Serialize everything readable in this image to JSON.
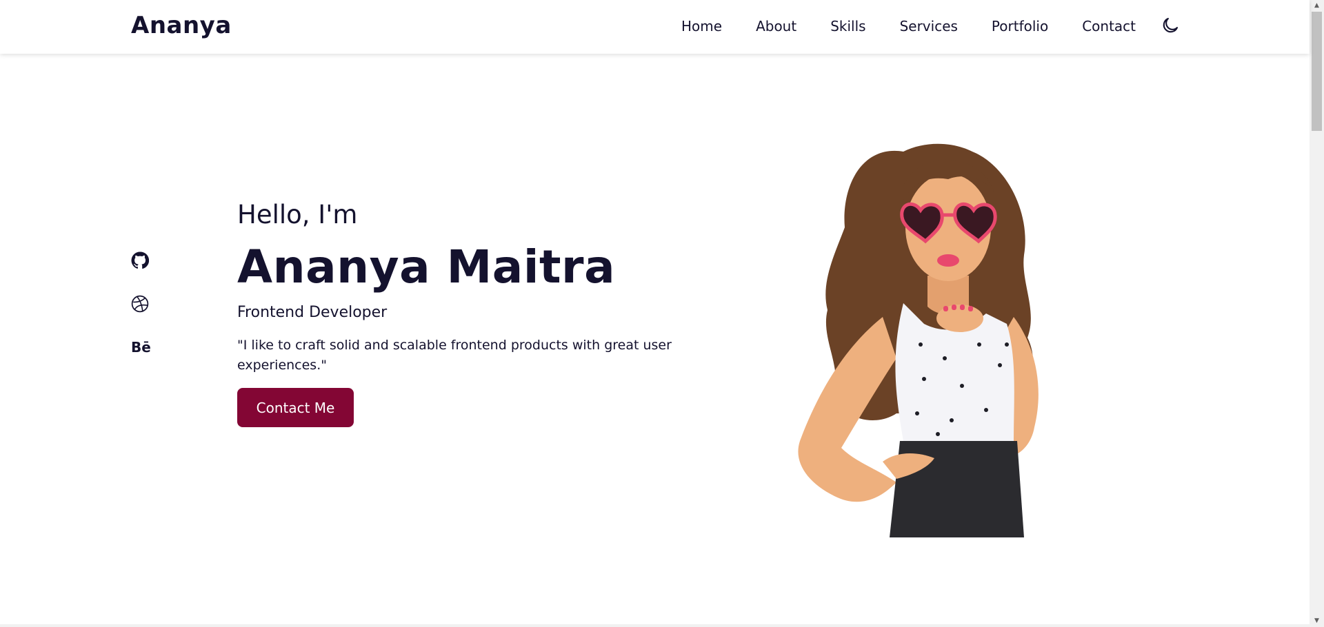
{
  "header": {
    "logo": "Ananya",
    "nav": [
      "Home",
      "About",
      "Skills",
      "Services",
      "Portfolio",
      "Contact"
    ],
    "theme_toggle_icon": "moon-icon"
  },
  "social": {
    "icons": [
      "github-icon",
      "dribbble-icon",
      "behance-icon"
    ],
    "behance_text": "Bē"
  },
  "hero": {
    "greeting": "Hello, I'm",
    "name": "Ananya Maitra",
    "role": "Frontend Developer",
    "quote": "\"I like to craft solid and scalable frontend products with great user experiences.\"",
    "cta_label": "Contact Me"
  },
  "colors": {
    "accent": "#830634",
    "text": "#14122e",
    "background": "#ffffff"
  }
}
